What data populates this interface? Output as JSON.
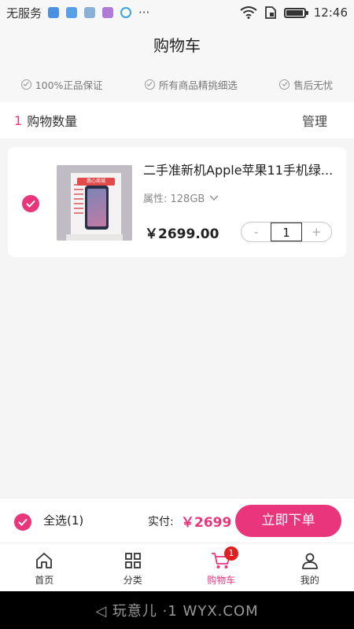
{
  "status_bar": {
    "carrier": "无服务",
    "time": "12:46",
    "dots": "···"
  },
  "header": {
    "title": "购物车"
  },
  "guarantees": [
    {
      "label": "100%正品保证"
    },
    {
      "label": "所有商品精挑细选"
    },
    {
      "label": "售后无忧"
    }
  ],
  "cart_summary": {
    "count": "1",
    "label": "购物数量",
    "manage": "管理"
  },
  "item": {
    "title": "二手准新机Apple苹果11手机绿...",
    "attribute": "属性: 128GB",
    "price": "￥2699.00",
    "quantity": "1",
    "minus": "-",
    "plus": "+",
    "thumb_badge": "惠心商城"
  },
  "checkout": {
    "select_all": "全选(1)",
    "paid_label": "实付:",
    "paid_value": "￥2699",
    "order_button": "立即下单"
  },
  "tabs": [
    {
      "label": "首页"
    },
    {
      "label": "分类"
    },
    {
      "label": "购物车",
      "badge": "1"
    },
    {
      "label": "我的"
    }
  ],
  "watermark": "◁ 玩意儿 ·1 WYX.COM",
  "colors": {
    "accent": "#e8357c",
    "badge": "#e02020"
  }
}
